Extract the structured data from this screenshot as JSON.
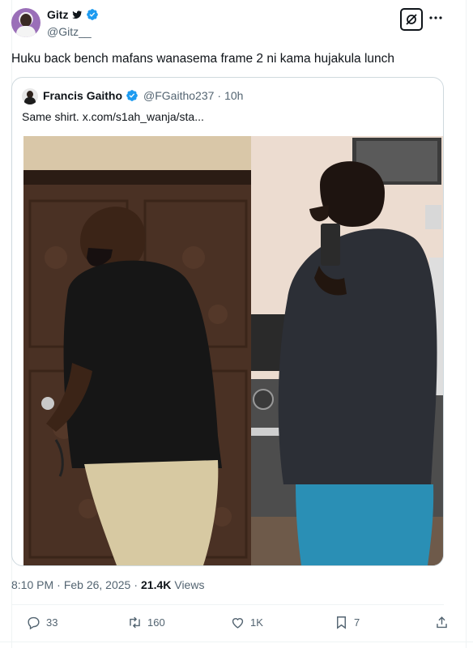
{
  "author": {
    "display_name": "Gitz",
    "handle": "@Gitz__",
    "badge_icon": "bird-icon",
    "verified_icon": "verified-icon"
  },
  "tweet": {
    "text": "Huku back bench mafans wanasema frame 2 ni kama hujakula lunch"
  },
  "quoted": {
    "display_name": "Francis Gaitho",
    "handle": "@FGaitho237",
    "separator": "·",
    "time_ago": "10h",
    "text": "Same shirt.  x.com/s1ah_wanja/sta..."
  },
  "meta": {
    "time": "8:10 PM",
    "separator": "·",
    "date": "Feb 26, 2025",
    "separator2": "·",
    "views_count": "21.4K",
    "views_label": "Views"
  },
  "actions": {
    "replies": "33",
    "reposts": "160",
    "likes": "1K",
    "bookmarks": "7"
  },
  "colors": {
    "accent": "#1d9bf0",
    "text_primary": "#0f1419",
    "text_secondary": "#536471",
    "border": "#cfd9de"
  }
}
